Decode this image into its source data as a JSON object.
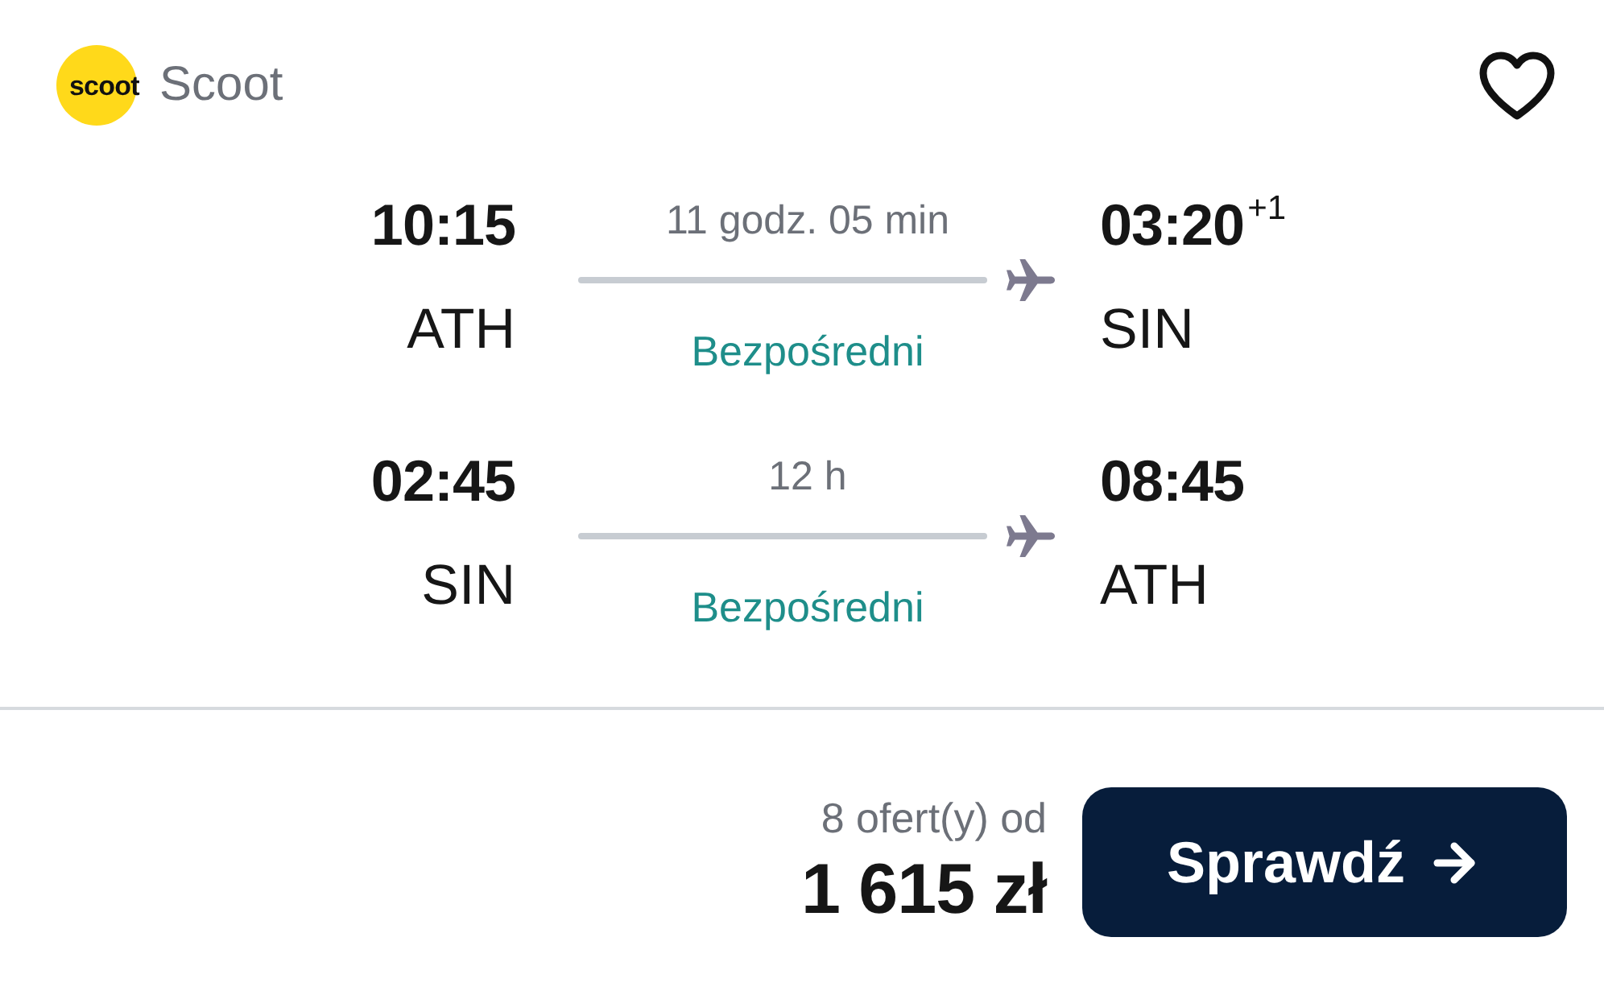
{
  "airline": {
    "logo_text": "scoot",
    "name": "Scoot"
  },
  "favorite_button": {
    "selected": false
  },
  "legs": [
    {
      "departure": {
        "time": "10:15",
        "airport": "ATH"
      },
      "duration": "11 godz. 05 min",
      "stops": "Bezpośredni",
      "arrival": {
        "time": "03:20",
        "day_offset": "+1",
        "airport": "SIN"
      }
    },
    {
      "departure": {
        "time": "02:45",
        "airport": "SIN"
      },
      "duration": "12 h",
      "stops": "Bezpośredni",
      "arrival": {
        "time": "08:45",
        "airport": "ATH"
      }
    }
  ],
  "footer": {
    "offers": "8 ofert(y) od",
    "price": "1 615 zł",
    "button": "Sprawdź"
  }
}
